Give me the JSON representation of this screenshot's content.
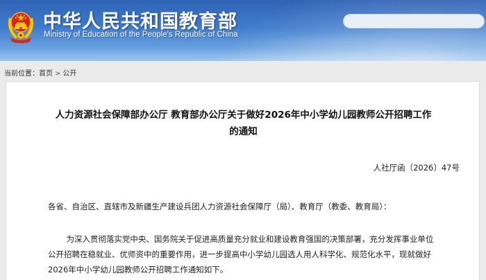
{
  "header": {
    "title_cn": "中华人民共和国教育部",
    "title_en": "Ministry of Education of the People's Republic of China",
    "search_placeholder": ""
  },
  "breadcrumb": {
    "prefix": "当前位置：",
    "items": [
      "首页",
      "公开"
    ],
    "separator": ">"
  },
  "article": {
    "title_line1": "人力资源社会保障部办公厅 教育部办公厅关于做好2026年中小学幼儿园教师公开招聘工作",
    "title_line2": "的通知",
    "doc_number": "人社厅函〔2026〕47号",
    "salutation": "各省、自治区、直辖市及新疆生产建设兵团人力资源社会保障厅（局）、教育厅（教委、教育局）：",
    "paragraph1": "为深入贯彻落实党中央、国务院关于促进高质量充分就业和建设教育强国的决策部署，充分发挥事业单位公开招聘在稳就业、优师资中的重要作用，进一步提高中小学幼儿园选人用人科学化、规范化水平，现就做好2026年中小学幼儿园教师公开招聘工作通知如下。"
  },
  "colors": {
    "banner_dark": "#2f63b4",
    "banner_light": "#9ec4ec",
    "page_background": "#ebebeb",
    "emblem_red": "#d8261c",
    "emblem_gold": "#f5c518"
  }
}
